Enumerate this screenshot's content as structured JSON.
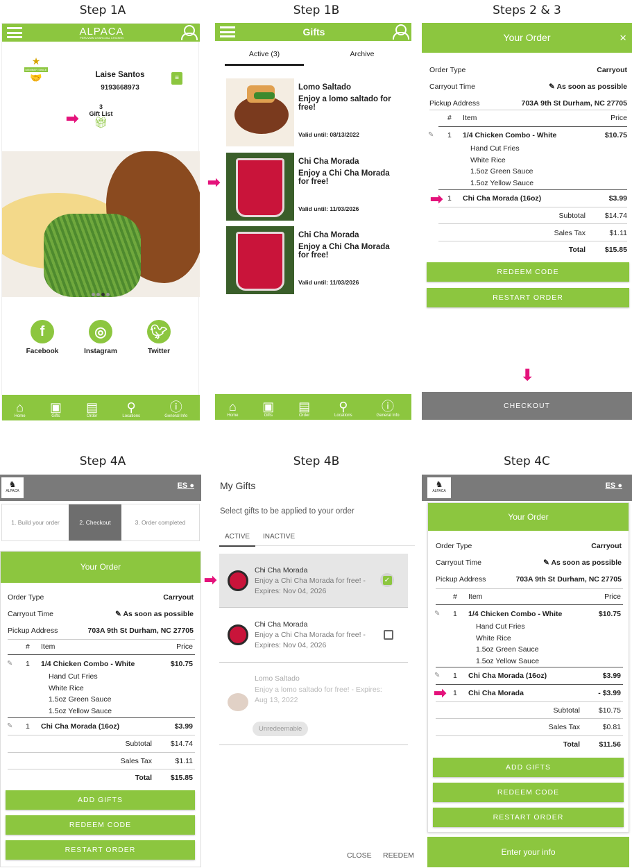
{
  "steps": {
    "s1a": "Step 1A",
    "s1b": "Step 1B",
    "s23": "Steps 2 & 3",
    "s4a": "Step 4A",
    "s4b": "Step 4B",
    "s4c": "Step 4C"
  },
  "colors": {
    "brand_green": "#8cc63f",
    "header_gray": "#7a7a7a",
    "arrow_pink": "#e4127b"
  },
  "s1a": {
    "logo": "ALPACA",
    "logo_sub": "PERUVIAN CHARCOAL CHICKEN",
    "badge": "MEMBER SINCE",
    "name": "Laise Santos",
    "phone": "9193668973",
    "gift_count": "3",
    "gift_list": "Gift List",
    "social": [
      "Facebook",
      "Instagram",
      "Twitter"
    ]
  },
  "nav": [
    "Home",
    "Gifts",
    "Order",
    "Locations",
    "General Info"
  ],
  "s1b": {
    "title": "Gifts",
    "tab_active": "Active (3)",
    "tab_archive": "Archive",
    "gifts": [
      {
        "title": "Lomo Saltado",
        "desc": "Enjoy a lomo saltado for free!",
        "valid": "Valid until: 08/13/2022"
      },
      {
        "title": "Chi Cha Morada",
        "desc": "Enjoy a Chi Cha Morada for free!",
        "valid": "Valid until: 11/03/2026"
      },
      {
        "title": "Chi Cha Morada",
        "desc": "Enjoy a Chi Cha Morada for free!",
        "valid": "Valid until: 11/03/2026"
      }
    ]
  },
  "order": {
    "title": "Your Order",
    "close": "×",
    "order_type_lbl": "Order Type",
    "order_type": "Carryout",
    "time_lbl": "Carryout Time",
    "time": "As soon as possible",
    "addr_lbl": "Pickup Address",
    "addr": "703A 9th St Durham, NC 27705",
    "col_num": "#",
    "col_item": "Item",
    "col_price": "Price",
    "item1": {
      "qty": "1",
      "name": "1/4 Chicken Combo - White",
      "price": "$10.75",
      "mods": [
        "Hand Cut Fries",
        "White Rice",
        "1.5oz Green Sauce",
        "1.5oz Yellow Sauce"
      ]
    },
    "item2": {
      "qty": "1",
      "name": "Chi Cha Morada (16oz)",
      "price": "$3.99"
    },
    "subtotal_lbl": "Subtotal",
    "subtotal": "$14.74",
    "tax_lbl": "Sales Tax",
    "tax": "$1.11",
    "total_lbl": "Total",
    "total": "$15.85",
    "redeem": "REDEEM CODE",
    "restart": "RESTART ORDER",
    "checkout": "CHECKOUT",
    "add_gifts": "ADD GIFTS"
  },
  "s4a": {
    "lang": "ES",
    "logo": "ALPACA",
    "step1": "1. Build your order",
    "step2": "2. Checkout",
    "step3": "3. Order completed"
  },
  "s4b": {
    "title": "My Gifts",
    "subtitle": "Select gifts to be applied to your order",
    "tab_active": "ACTIVE",
    "tab_inactive": "INACTIVE",
    "gifts": [
      {
        "title": "Chi Cha Morada",
        "desc": "Enjoy a Chi Cha Morada for free! - Expires: Nov 04, 2026",
        "checked": true
      },
      {
        "title": "Chi Cha Morada",
        "desc": "Enjoy a Chi Cha Morada for free! - Expires: Nov 04, 2026",
        "checked": false
      },
      {
        "title": "Lomo Saltado",
        "desc": "Enjoy a lomo saltado for free! - Expires: Aug 13, 2022",
        "tag": "Unredeemable"
      }
    ],
    "close": "CLOSE",
    "redeem": "REEDEM"
  },
  "s4c": {
    "item3": {
      "qty": "1",
      "name": "Chi Cha Morada",
      "price": "- $3.99"
    },
    "subtotal": "$10.75",
    "tax": "$0.81",
    "total": "$11.56",
    "enter_info": "Enter your info"
  }
}
